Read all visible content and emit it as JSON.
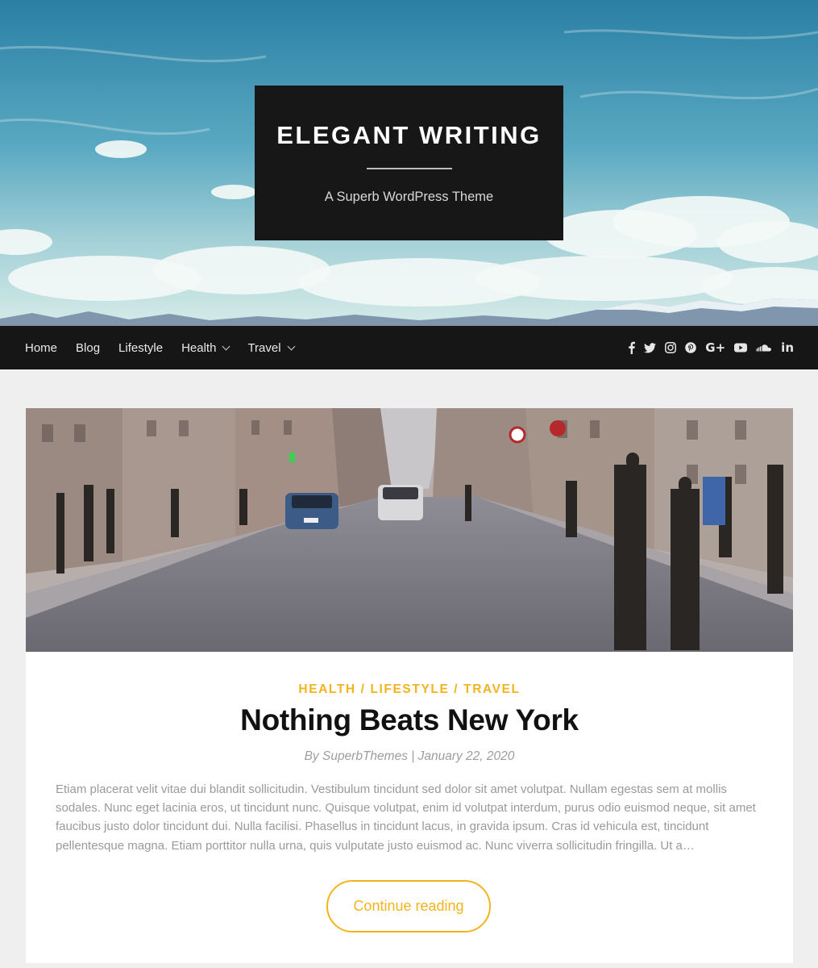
{
  "site": {
    "title": "ELEGANT WRITING",
    "tagline": "A Superb WordPress Theme"
  },
  "nav": {
    "items": [
      {
        "label": "Home",
        "dropdown": false
      },
      {
        "label": "Blog",
        "dropdown": false
      },
      {
        "label": "Lifestyle",
        "dropdown": false
      },
      {
        "label": "Health",
        "dropdown": true
      },
      {
        "label": "Travel",
        "dropdown": true
      }
    ],
    "social": [
      "facebook-icon",
      "twitter-icon",
      "instagram-icon",
      "pinterest-icon",
      "google-plus-icon",
      "youtube-icon",
      "soundcloud-icon",
      "linkedin-icon"
    ]
  },
  "post": {
    "categories": [
      "HEALTH",
      "LIFESTYLE",
      "TRAVEL"
    ],
    "category_separator": " / ",
    "title": "Nothing Beats New York",
    "author_prefix": "By ",
    "author": "SuperbThemes",
    "meta_separator": " | ",
    "date": "January 22, 2020",
    "excerpt": "Etiam placerat velit vitae dui blandit sollicitudin. Vestibulum tincidunt sed dolor sit amet volutpat. Nullam egestas sem at mollis sodales. Nunc eget lacinia eros, ut tincidunt nunc. Quisque volutpat, enim id volutpat interdum, purus odio euismod neque, sit amet faucibus justo dolor tincidunt dui. Nulla facilisi. Phasellus in tincidunt lacus, in gravida ipsum. Cras id vehicula est, tincidunt pellentesque magna. Etiam porttitor nulla urna, quis vulputate justo euismod ac. Nunc viverra sollicitudin fringilla. Ut a…",
    "continue_label": "Continue reading"
  },
  "colors": {
    "accent": "#f2b31d",
    "nav_bg": "#161616",
    "title_box_bg": "#171717",
    "page_bg": "#efefef"
  }
}
